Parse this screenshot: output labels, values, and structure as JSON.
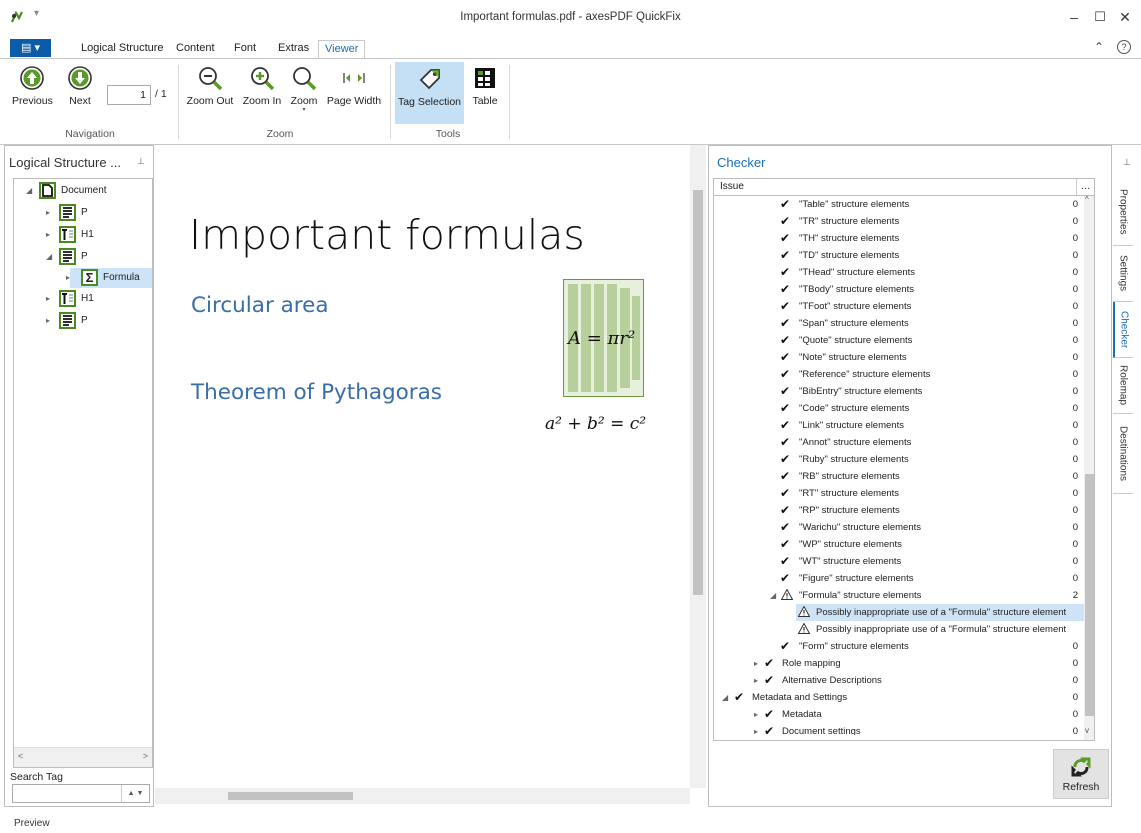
{
  "window": {
    "title": "Important formulas.pdf - axesPDF QuickFix",
    "minimize": "–",
    "maximize": "☐",
    "close": "✕",
    "qat_glyph": "▾",
    "ribbon_collapse": "⌃",
    "help": "?"
  },
  "ribbon": {
    "file_label": "▤ ▾",
    "tabs": [
      "Logical Structure",
      "Content",
      "Font",
      "Extras",
      "Viewer"
    ],
    "active_tab": "Viewer",
    "buttons": {
      "previous": "Previous",
      "next": "Next",
      "page_current": "1",
      "page_total": "/ 1",
      "zoom_out": "Zoom Out",
      "zoom_in": "Zoom In",
      "zoom": "Zoom",
      "page_width": "Page Width",
      "tag_selection": "Tag Selection",
      "table": "Table"
    },
    "groups": {
      "navigation": "Navigation",
      "zoom": "Zoom",
      "tools": "Tools"
    }
  },
  "logical_structure": {
    "title": "Logical Structure ...",
    "pin": "⊥",
    "tree": [
      {
        "label": "Document"
      },
      {
        "label": "P"
      },
      {
        "label": "H1"
      },
      {
        "label": "P"
      },
      {
        "label": "Formula",
        "icon": "Σ"
      },
      {
        "label": "H1"
      },
      {
        "label": "P"
      }
    ],
    "search_label": "Search Tag",
    "search_value": ""
  },
  "document": {
    "title": "Important formulas",
    "heading1": "Circular area",
    "heading2": "Theorem of Pythagoras",
    "formula1": "A = πr²",
    "formula2": "a² + b² = c²"
  },
  "checker": {
    "title": "Checker",
    "column": "Issue",
    "column_menu": "…",
    "rows": [
      {
        "label": "\"Table\" structure elements",
        "count": "0"
      },
      {
        "label": "\"TR\" structure elements",
        "count": "0"
      },
      {
        "label": "\"TH\" structure elements",
        "count": "0"
      },
      {
        "label": "\"TD\" structure elements",
        "count": "0"
      },
      {
        "label": "\"THead\" structure elements",
        "count": "0"
      },
      {
        "label": "\"TBody\" structure elements",
        "count": "0"
      },
      {
        "label": "\"TFoot\" structure elements",
        "count": "0"
      },
      {
        "label": "\"Span\" structure elements",
        "count": "0"
      },
      {
        "label": "\"Quote\" structure elements",
        "count": "0"
      },
      {
        "label": "\"Note\" structure elements",
        "count": "0"
      },
      {
        "label": "\"Reference\" structure elements",
        "count": "0"
      },
      {
        "label": "\"BibEntry\" structure elements",
        "count": "0"
      },
      {
        "label": "\"Code\" structure elements",
        "count": "0"
      },
      {
        "label": "\"Link\" structure elements",
        "count": "0"
      },
      {
        "label": "\"Annot\" structure elements",
        "count": "0"
      },
      {
        "label": "\"Ruby\" structure elements",
        "count": "0"
      },
      {
        "label": "\"RB\" structure elements",
        "count": "0"
      },
      {
        "label": "\"RT\" structure elements",
        "count": "0"
      },
      {
        "label": "\"RP\" structure elements",
        "count": "0"
      },
      {
        "label": "\"Warichu\" structure elements",
        "count": "0"
      },
      {
        "label": "\"WP\" structure elements",
        "count": "0"
      },
      {
        "label": "\"WT\" structure elements",
        "count": "0"
      },
      {
        "label": "\"Figure\" structure elements",
        "count": "0"
      },
      {
        "label": "\"Formula\" structure elements",
        "count": "2"
      },
      {
        "label": "Possibly inappropriate use of a \"Formula\" structure element",
        "count": ""
      },
      {
        "label": "Possibly inappropriate use of a \"Formula\" structure element",
        "count": ""
      },
      {
        "label": "\"Form\" structure elements",
        "count": "0"
      },
      {
        "label": "Role mapping",
        "count": "0"
      },
      {
        "label": "Alternative Descriptions",
        "count": "0"
      },
      {
        "label": "Metadata and Settings",
        "count": "0"
      },
      {
        "label": "Metadata",
        "count": "0"
      },
      {
        "label": "Document settings",
        "count": "0"
      }
    ],
    "refresh": "Refresh"
  },
  "side_tabs": [
    "Properties",
    "Settings",
    "Checker",
    "Rolemap",
    "Destinations"
  ],
  "status": "Preview",
  "colors": {
    "accent": "#1a6fb5",
    "file_button": "#0b5ba8",
    "tag_green": "#4a8a1e",
    "heading_blue": "#3a6ea8",
    "selection": "#cfe3f6"
  }
}
